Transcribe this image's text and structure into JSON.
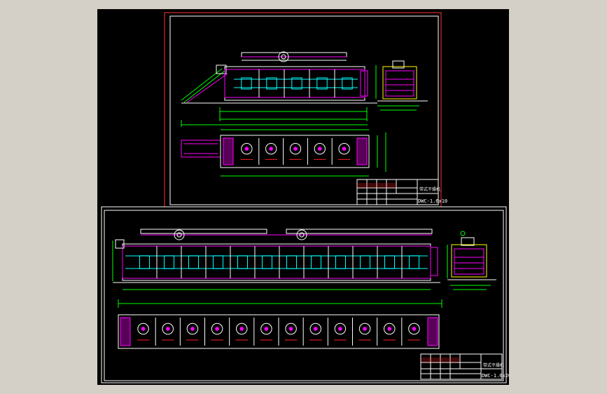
{
  "sheets": [
    {
      "id": "sheet-top",
      "title_code": "DWC-1.6x10",
      "title_name": "带式干燥机"
    },
    {
      "id": "sheet-bottom",
      "title_code": "DWC-1.6x20",
      "title_name": "带式干燥机"
    }
  ],
  "colors": {
    "background": "#000000",
    "frame": "#ffffff",
    "top_sheet_border": "#ff3030",
    "outline": "#ffffff",
    "machine": "#ff00ff",
    "dimension": "#00ff00",
    "detail": "#00ffff",
    "fan": "#ffff00",
    "accent_red": "#ff2020"
  }
}
